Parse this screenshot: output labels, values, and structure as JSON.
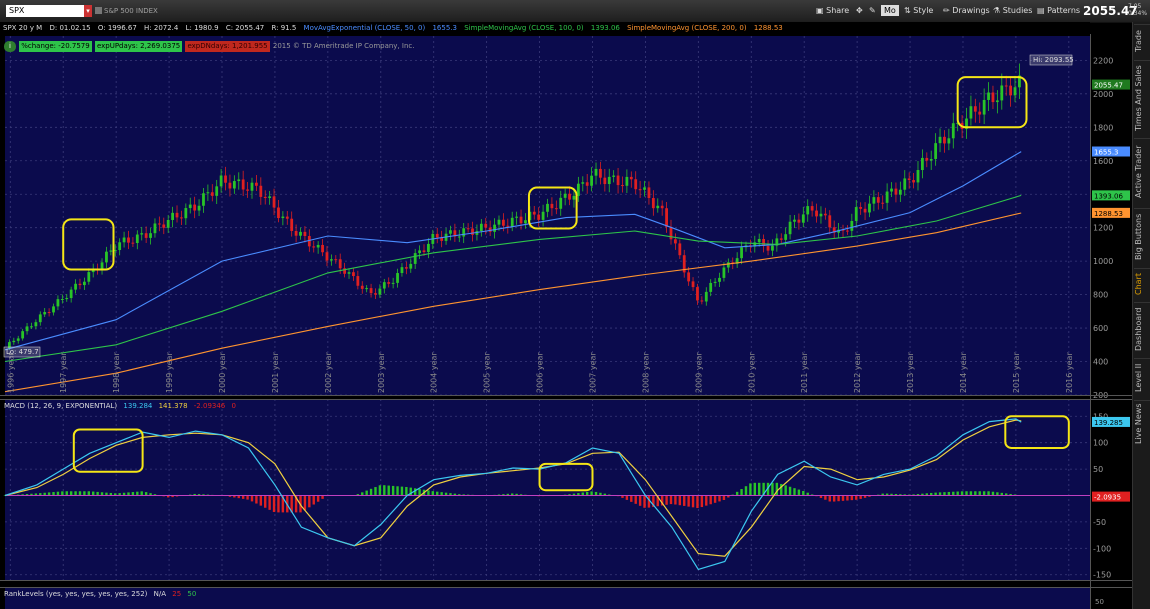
{
  "toolbar": {
    "symbol": "SPX",
    "description": "S&P 500 INDEX",
    "share": "Share",
    "style_badge": "Mo",
    "style": "Style",
    "drawings": "Drawings",
    "studies": "Studies",
    "patterns": "Patterns",
    "last_price": "2055.47",
    "change_1": "7.05",
    "change_2": "0.34%"
  },
  "infobar": {
    "label": "SPX 20 y M",
    "date": "D: 01.02.15",
    "open": "O: 1996.67",
    "high": "H: 2072.4",
    "low": "L: 1980.9",
    "close": "C: 2055.47",
    "range": "R: 91.5",
    "ema50": "MovAvgExponential (CLOSE, 50, 0)",
    "ema50_val": "1655.3",
    "sma100": "SimpleMovingAvg (CLOSE, 100, 0)",
    "sma100_val": "1393.06",
    "sma200": "SimpleMovingAvg (CLOSE, 200, 0)",
    "sma200_val": "1288.53"
  },
  "studybar": {
    "pct": "%change: -20.7579",
    "up": "expUPdays: 2,269.0375",
    "down": "expDNdays: 1,201.955",
    "copyright": "2015 © TD Ameritrade IP Company, Inc."
  },
  "labels": {
    "high_flag": "Hi: 2093.55",
    "low_flag": "Lo: 479.7"
  },
  "macd": {
    "header": "MACD (12, 26, 9, EXPONENTIAL)",
    "value": "139.284",
    "avg": "141.378",
    "diff": "-2.09346",
    "zero": "0",
    "value_badge": "139.285",
    "diff_badge": "-2.0935"
  },
  "rank": {
    "header": "RankLevels (yes, yes, yes, yes, yes, 252)",
    "na": "N/A",
    "v1": "25",
    "v2": "50",
    "axis": "50"
  },
  "sidebar": [
    "Trade",
    "Times And Sales",
    "Active Trader",
    "Big Buttons",
    "Chart",
    "Dashboard",
    "Level II",
    "Live News"
  ],
  "colors": {
    "panel_bg": "#0b0b4d",
    "up_candle": "#28c428",
    "down_candle": "#e02020",
    "ema50": "#4a8cff",
    "sma100": "#2ec44a",
    "sma200": "#ff9430",
    "macd_line": "#3cc8f0",
    "signal_line": "#f0d040",
    "highlight_box": "#f5e616"
  },
  "chart_data": [
    {
      "type": "candlestick",
      "title": "SPX 20 y M",
      "x": [
        "1996",
        "1997",
        "1998",
        "1999",
        "2000",
        "2001",
        "2002",
        "2003",
        "2004",
        "2005",
        "2006",
        "2007",
        "2008",
        "2009",
        "2010",
        "2011",
        "2012",
        "2013",
        "2014",
        "2015",
        "2016"
      ],
      "x_suffix": "year",
      "ylim": [
        200,
        2250
      ],
      "yticks": [
        200,
        400,
        600,
        800,
        1000,
        1200,
        1400,
        1600,
        1800,
        2000,
        2200
      ],
      "price_path": {
        "x": [
          1995.9,
          1996.5,
          1997.0,
          1997.6,
          1998.0,
          1998.5,
          1998.9,
          1999.5,
          2000.0,
          2000.7,
          2001.3,
          2001.7,
          2002.3,
          2002.8,
          2003.2,
          2004.0,
          2005.0,
          2006.0,
          2006.7,
          2007.0,
          2007.4,
          2007.8,
          2008.0,
          2008.3,
          2008.8,
          2009.0,
          2009.4,
          2010.0,
          2010.4,
          2010.7,
          2011.0,
          2011.2,
          2011.7,
          2012.0,
          2012.5,
          2013.0,
          2013.5,
          2014.0,
          2014.5,
          2015.0,
          2015.1
        ],
        "y": [
          480,
          650,
          780,
          950,
          1100,
          1150,
          1230,
          1330,
          1480,
          1430,
          1200,
          1100,
          950,
          800,
          880,
          1140,
          1200,
          1280,
          1420,
          1520,
          1480,
          1470,
          1400,
          1300,
          900,
          750,
          920,
          1120,
          1080,
          1200,
          1290,
          1310,
          1150,
          1300,
          1380,
          1480,
          1690,
          1840,
          1970,
          2055,
          2060
        ]
      },
      "high_marker": 2093.55,
      "low_marker": 479.7,
      "last": 2055.47,
      "series": [
        {
          "name": "MovAvgExponential (CLOSE, 50, 0)",
          "last": 1655.3,
          "x": [
            1995.9,
            1998.0,
            2000.0,
            2002.0,
            2003.5,
            2005.0,
            2006.5,
            2007.8,
            2008.5,
            2009.5,
            2010.5,
            2011.5,
            2013.0,
            2014.0,
            2015.1
          ],
          "y": [
            470,
            650,
            1000,
            1150,
            1110,
            1180,
            1260,
            1280,
            1200,
            1080,
            1100,
            1170,
            1290,
            1450,
            1655
          ]
        },
        {
          "name": "SimpleMovingAvg (CLOSE, 100, 0)",
          "last": 1393.06,
          "x": [
            1995.9,
            1998.0,
            2000.0,
            2002.0,
            2004.0,
            2006.0,
            2007.8,
            2009.0,
            2010.5,
            2012.0,
            2013.5,
            2015.1
          ],
          "y": [
            400,
            500,
            700,
            930,
            1050,
            1130,
            1180,
            1120,
            1100,
            1150,
            1240,
            1393
          ]
        },
        {
          "name": "SimpleMovingAvg (CLOSE, 200, 0)",
          "last": 1288.53,
          "x": [
            1995.9,
            1998.0,
            2000.0,
            2002.0,
            2004.0,
            2006.0,
            2008.0,
            2010.0,
            2012.0,
            2013.5,
            2015.1
          ],
          "y": [
            220,
            330,
            480,
            610,
            730,
            830,
            920,
            1000,
            1090,
            1170,
            1288
          ]
        }
      ],
      "highlights": [
        [
          1997.0,
          1997.95,
          950,
          1250
        ],
        [
          2005.8,
          2006.7,
          1195,
          1440
        ],
        [
          2013.9,
          2015.2,
          1800,
          2100
        ]
      ]
    },
    {
      "type": "line",
      "title": "MACD (12, 26, 9, EXPONENTIAL)",
      "ylim": [
        -160,
        160
      ],
      "yticks": [
        -150,
        -100,
        -50,
        0,
        50,
        100,
        150
      ],
      "series": [
        {
          "name": "Value",
          "x": [
            1995.9,
            1996.5,
            1997.0,
            1997.5,
            1998.0,
            1998.5,
            1999.0,
            1999.5,
            2000.0,
            2000.5,
            2001.0,
            2001.5,
            2002.0,
            2002.5,
            2003.0,
            2003.5,
            2004.0,
            2004.5,
            2005.0,
            2005.5,
            2006.0,
            2006.5,
            2007.0,
            2007.5,
            2008.0,
            2008.5,
            2009.0,
            2009.5,
            2010.0,
            2010.5,
            2011.0,
            2011.5,
            2012.0,
            2012.5,
            2013.0,
            2013.5,
            2014.0,
            2014.5,
            2015.0,
            2015.1
          ],
          "y": [
            0,
            20,
            50,
            80,
            100,
            120,
            110,
            122,
            115,
            90,
            20,
            -60,
            -80,
            -95,
            -55,
            0,
            30,
            38,
            42,
            52,
            50,
            62,
            90,
            80,
            0,
            -60,
            -140,
            -125,
            -30,
            40,
            65,
            35,
            20,
            40,
            50,
            75,
            115,
            140,
            145,
            139
          ]
        },
        {
          "name": "Avg",
          "x": [
            1995.9,
            1996.5,
            1997.0,
            1997.5,
            1998.0,
            1998.5,
            1999.0,
            1999.5,
            2000.0,
            2000.5,
            2001.0,
            2001.5,
            2002.0,
            2002.5,
            2003.0,
            2003.5,
            2004.0,
            2004.5,
            2005.0,
            2005.5,
            2006.0,
            2006.5,
            2007.0,
            2007.5,
            2008.0,
            2008.5,
            2009.0,
            2009.5,
            2010.0,
            2010.5,
            2011.0,
            2011.5,
            2012.0,
            2012.5,
            2013.0,
            2013.5,
            2014.0,
            2014.5,
            2015.0,
            2015.1
          ],
          "y": [
            0,
            15,
            40,
            70,
            95,
            110,
            115,
            118,
            115,
            100,
            60,
            -20,
            -80,
            -95,
            -80,
            -20,
            20,
            35,
            42,
            47,
            52,
            60,
            80,
            82,
            30,
            -40,
            -110,
            -115,
            -60,
            10,
            55,
            50,
            30,
            35,
            48,
            68,
            105,
            130,
            143,
            141
          ]
        }
      ],
      "highlights": [
        [
          1997.2,
          1998.5,
          45,
          125
        ],
        [
          2006.0,
          2007.0,
          10,
          60
        ],
        [
          2014.8,
          2016.0,
          90,
          150
        ]
      ]
    }
  ]
}
